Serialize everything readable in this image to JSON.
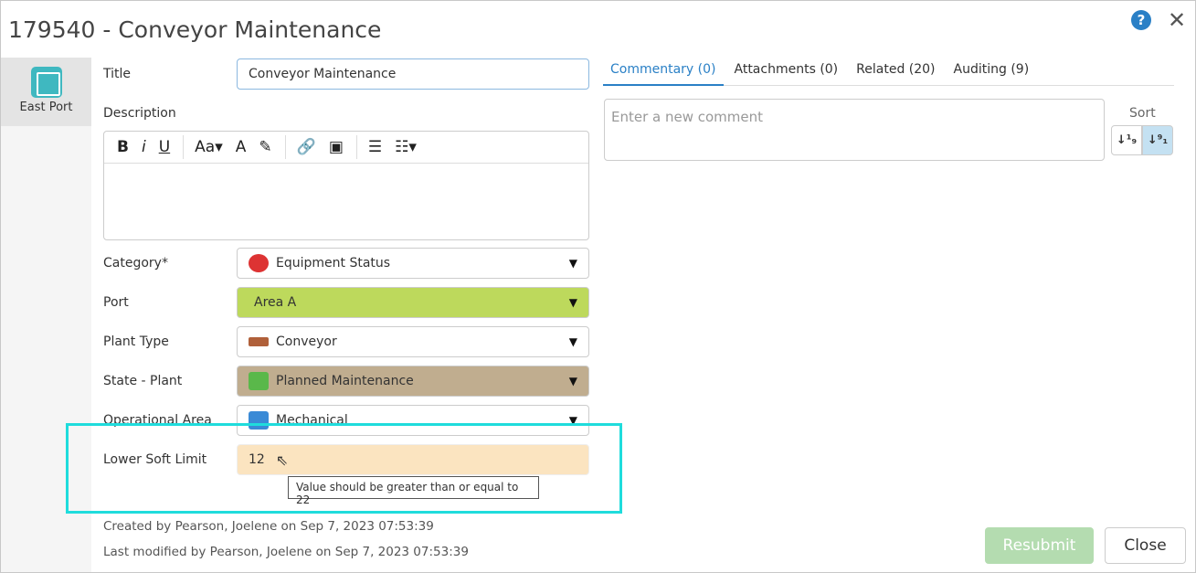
{
  "window": {
    "title": "179540 - Conveyor Maintenance"
  },
  "sidebar": {
    "items": [
      {
        "label": "East Port"
      }
    ]
  },
  "form": {
    "title_label": "Title",
    "title_value": "Conveyor Maintenance",
    "description_label": "Description",
    "category_label": "Category*",
    "category_value": "Equipment Status",
    "port_label": "Port",
    "port_value": "Area A",
    "plant_type_label": "Plant Type",
    "plant_type_value": "Conveyor",
    "state_label": "State - Plant",
    "state_value": "Planned Maintenance",
    "op_area_label": "Operational Area",
    "op_area_value": "Mechanical",
    "lower_soft_limit_label": "Lower Soft Limit",
    "lower_soft_limit_value": "12",
    "tooltip": "Value should be greater than or equal to 22"
  },
  "meta": {
    "created": "Created by Pearson, Joelene on Sep 7, 2023 07:53:39",
    "modified": "Last modified by Pearson, Joelene on Sep 7, 2023 07:53:39"
  },
  "tabs": [
    {
      "label": "Commentary (0)"
    },
    {
      "label": "Attachments (0)"
    },
    {
      "label": "Related (20)"
    },
    {
      "label": "Auditing (9)"
    }
  ],
  "comment": {
    "placeholder": "Enter a new comment",
    "sort_label": "Sort"
  },
  "buttons": {
    "resubmit": "Resubmit",
    "close": "Close"
  },
  "colors": {
    "port": "#bdd95c",
    "state": "#c0ad8f",
    "limit": "#fbe4c0",
    "accent": "#2a80c6",
    "highlight": "#1fdcdc"
  }
}
